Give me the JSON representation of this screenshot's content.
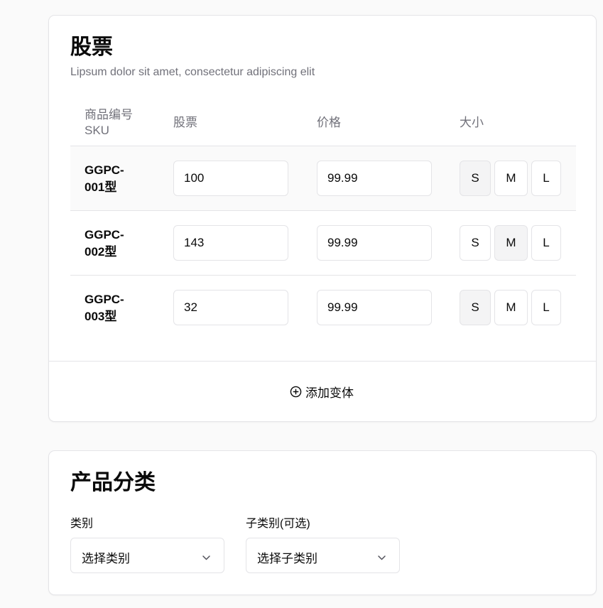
{
  "stock_card": {
    "title": "股票",
    "description": "Lipsum dolor sit amet, consectetur adipiscing elit",
    "columns": {
      "sku": "商品编号SKU",
      "stock": "股票",
      "price": "价格",
      "size": "大小"
    },
    "rows": [
      {
        "sku": "GGPC-001型",
        "stock": "100",
        "price": "99.99",
        "selected_size": "S"
      },
      {
        "sku": "GGPC-002型",
        "stock": "143",
        "price": "99.99",
        "selected_size": "M"
      },
      {
        "sku": "GGPC-003型",
        "stock": "32",
        "price": "99.99",
        "selected_size": "S"
      }
    ],
    "size_options": [
      "S",
      "M",
      "L"
    ],
    "add_variant_label": "添加变体"
  },
  "category_card": {
    "title": "产品分类",
    "category_label": "类别",
    "category_placeholder": "选择类别",
    "subcategory_label": "子类别(可选)",
    "subcategory_placeholder": "选择子类别"
  },
  "icons": {
    "add": "plus-circle-icon",
    "dropdown": "chevron-down-icon"
  },
  "colors": {
    "border": "#e4e4e7",
    "muted_text": "#71717a",
    "selected_bg": "#f4f4f5"
  }
}
